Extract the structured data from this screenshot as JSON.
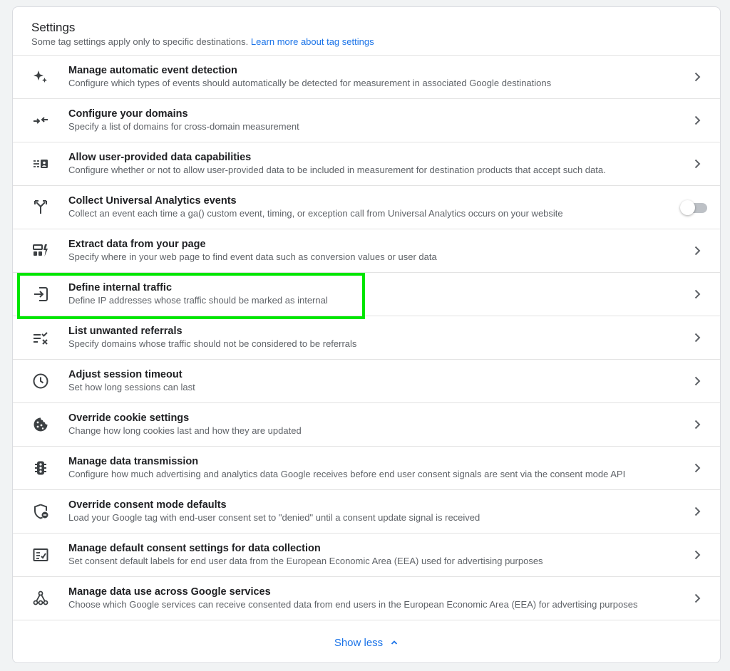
{
  "header": {
    "title": "Settings",
    "subtitle": "Some tag settings apply only to specific destinations.",
    "learn_more_link": "Learn more about tag settings"
  },
  "rows": [
    {
      "icon": "sparkle-icon",
      "title": "Manage automatic event detection",
      "description": "Configure which types of events should automatically be detected for measurement in associated Google destinations",
      "control": "chevron"
    },
    {
      "icon": "domains-arrows-icon",
      "title": "Configure your domains",
      "description": "Specify a list of domains for cross-domain measurement",
      "control": "chevron"
    },
    {
      "icon": "user-data-icon",
      "title": "Allow user-provided data capabilities",
      "description": "Configure whether or not to allow user-provided data to be included in measurement for destination products that accept such data.",
      "control": "chevron"
    },
    {
      "icon": "merge-arrows-icon",
      "title": "Collect Universal Analytics events",
      "description": "Collect an event each time a ga() custom event, timing, or exception call from Universal Analytics occurs on your website",
      "control": "toggle",
      "toggle_on": false
    },
    {
      "icon": "extract-data-icon",
      "title": "Extract data from your page",
      "description": "Specify where in your web page to find event data such as conversion values or user data",
      "control": "chevron"
    },
    {
      "icon": "login-icon",
      "title": "Define internal traffic",
      "description": "Define IP addresses whose traffic should be marked as internal",
      "control": "chevron",
      "highlighted": true
    },
    {
      "icon": "list-remove-icon",
      "title": "List unwanted referrals",
      "description": "Specify domains whose traffic should not be considered to be referrals",
      "control": "chevron"
    },
    {
      "icon": "clock-icon",
      "title": "Adjust session timeout",
      "description": "Set how long sessions can last",
      "control": "chevron"
    },
    {
      "icon": "cookie-icon",
      "title": "Override cookie settings",
      "description": "Change how long cookies last and how they are updated",
      "control": "chevron"
    },
    {
      "icon": "traffic-light-icon",
      "title": "Manage data transmission",
      "description": "Configure how much advertising and analytics data Google receives before end user consent signals are sent via the consent mode API",
      "control": "chevron"
    },
    {
      "icon": "shield-minus-icon",
      "title": "Override consent mode defaults",
      "description": "Load your Google tag with end-user consent set to \"denied\" until a consent update signal is received",
      "control": "chevron"
    },
    {
      "icon": "checklist-icon",
      "title": "Manage default consent settings for data collection",
      "description": "Set consent default labels for end user data from the European Economic Area (EEA) used for advertising purposes",
      "control": "chevron"
    },
    {
      "icon": "hub-icon",
      "title": "Manage data use across Google services",
      "description": "Choose which Google services can receive consented data from end users in the European Economic Area (EEA) for advertising purposes",
      "control": "chevron"
    }
  ],
  "footer": {
    "show_less_label": "Show less"
  },
  "colors": {
    "link": "#1a73e8",
    "highlight": "#00e600",
    "icon": "#3c4043",
    "toggle_off_track": "#bdc1c6"
  }
}
